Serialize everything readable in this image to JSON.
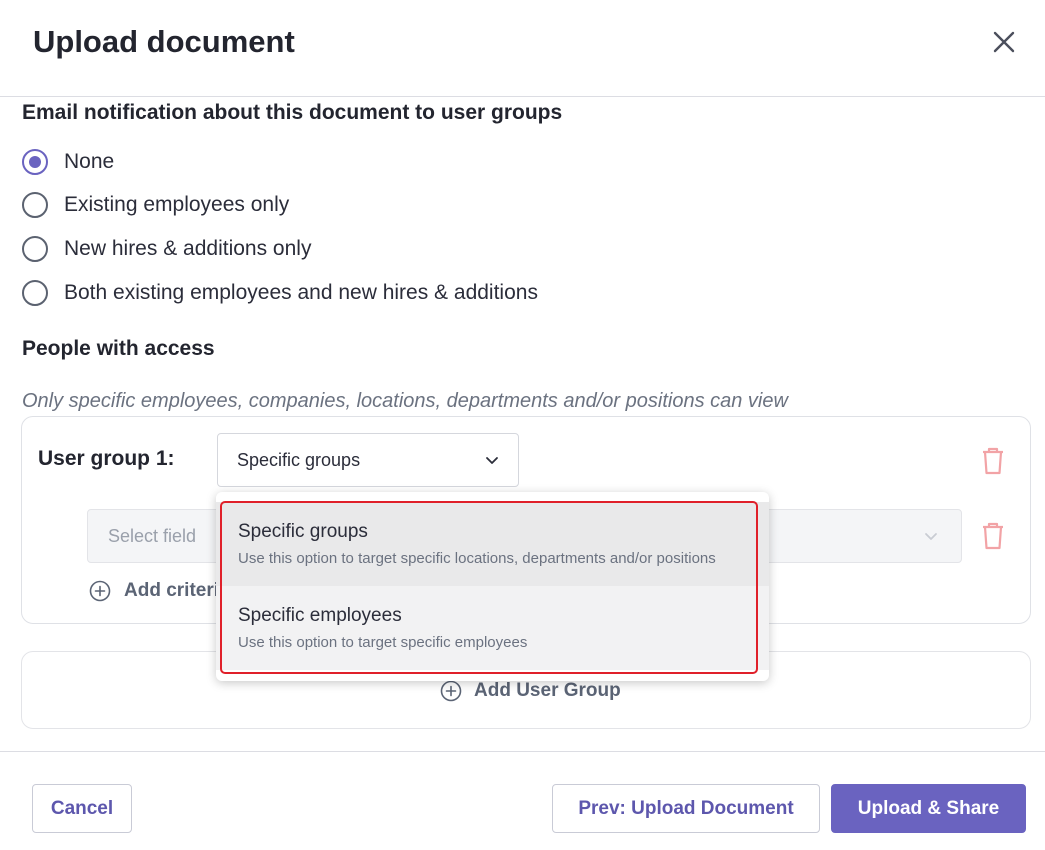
{
  "dialog": {
    "title": "Upload document"
  },
  "notification": {
    "heading": "Email notification about this document to user groups",
    "options": [
      {
        "label": "None",
        "checked": true
      },
      {
        "label": "Existing employees only",
        "checked": false
      },
      {
        "label": "New hires & additions only",
        "checked": false
      },
      {
        "label": "Both existing employees and new hires & additions",
        "checked": false
      }
    ]
  },
  "access": {
    "heading": "People with access",
    "subtitle": "Only specific employees, companies, locations, departments and/or positions can view",
    "group": {
      "label": "User group 1:",
      "selected": "Specific groups",
      "field_placeholder": "Select field",
      "add_criteria_label": "Add criteria"
    },
    "add_group_label": "Add User Group"
  },
  "dropdown": {
    "options": [
      {
        "title": "Specific groups",
        "description": "Use this option to target specific locations, departments and/or positions"
      },
      {
        "title": "Specific employees",
        "description": "Use this option to target specific employees"
      }
    ]
  },
  "footer": {
    "cancel_label": "Cancel",
    "prev_label": "Prev: Upload Document",
    "primary_label": "Upload & Share"
  },
  "colors": {
    "accent": "#6a63c0",
    "delete": "#f2a3a6",
    "highlight": "#e0202a"
  },
  "icons": [
    "close-icon",
    "chevron-down-icon",
    "trash-icon",
    "plus-circle-icon"
  ]
}
